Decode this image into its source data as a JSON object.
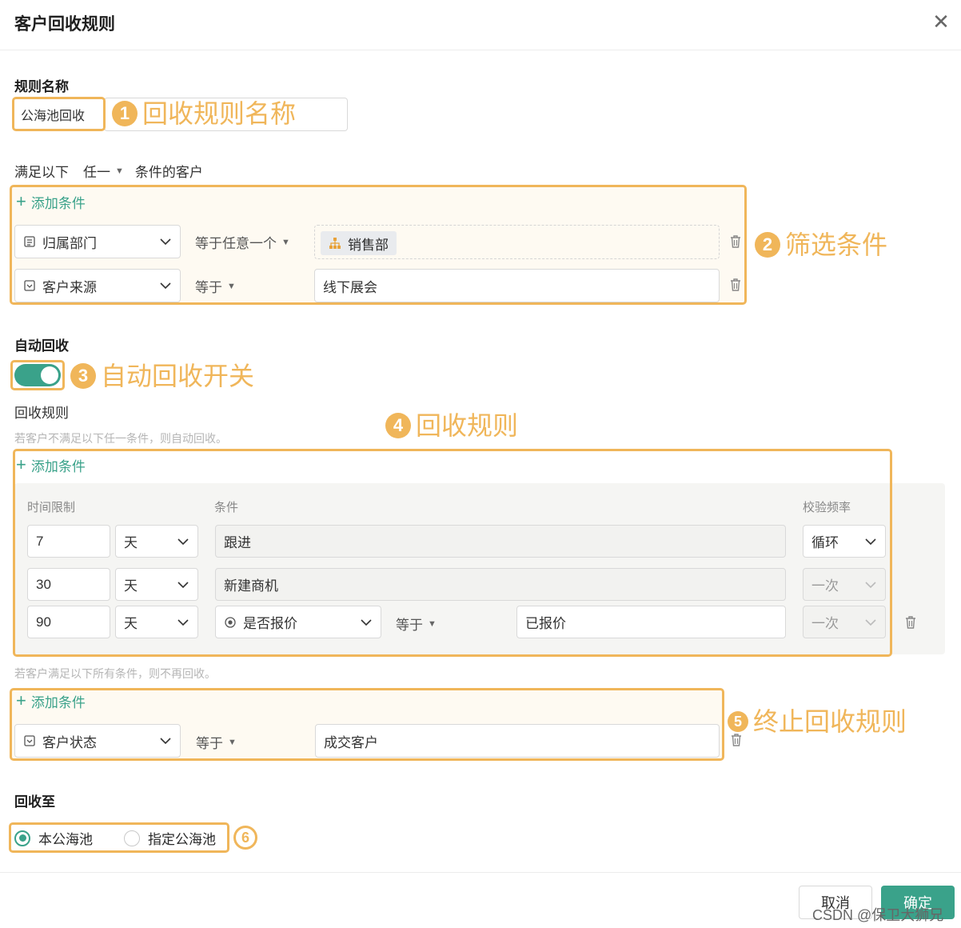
{
  "dialog": {
    "title": "客户回收规则",
    "close_icon": "close-icon"
  },
  "rule_name": {
    "label": "规则名称",
    "value": "公海池回收",
    "annotation_num": "1",
    "annotation": "回收规则名称"
  },
  "filter": {
    "prefix": "满足以下",
    "match": "任一",
    "suffix": "条件的客户",
    "add_label": "添加条件",
    "annotation_num": "2",
    "annotation": "筛选条件",
    "rows": [
      {
        "field": "归属部门",
        "operator": "等于任意一个",
        "value": "销售部"
      },
      {
        "field": "客户来源",
        "operator": "等于",
        "value": "线下展会"
      }
    ]
  },
  "auto_recycle": {
    "label": "自动回收",
    "enabled": true,
    "annotation_num": "3",
    "annotation": "自动回收开关"
  },
  "recycle_rule": {
    "label": "回收规则",
    "hint": "若客户不满足以下任一条件，则自动回收。",
    "add_label": "添加条件",
    "annotation_num": "4",
    "annotation": "回收规则",
    "columns": {
      "time": "时间限制",
      "condition": "条件",
      "freq": "校验频率"
    },
    "rows": [
      {
        "num": "7",
        "unit": "天",
        "condition": "跟进",
        "freq": "循环"
      },
      {
        "num": "30",
        "unit": "天",
        "condition": "新建商机",
        "freq": "一次"
      },
      {
        "num": "90",
        "unit": "天",
        "condition": "是否报价",
        "operator": "等于",
        "value": "已报价",
        "freq": "一次"
      }
    ]
  },
  "stop_rule": {
    "hint": "若客户满足以下所有条件，则不再回收。",
    "add_label": "添加条件",
    "annotation_num": "5",
    "annotation": "终止回收规则",
    "rows": [
      {
        "field": "客户状态",
        "operator": "等于",
        "value": "成交客户"
      }
    ]
  },
  "recycle_to": {
    "label": "回收至",
    "options": [
      "本公海池",
      "指定公海池"
    ],
    "selected": "本公海池",
    "annotation_num": "6"
  },
  "footer": {
    "cancel": "取消",
    "confirm": "确定",
    "watermark": "CSDN @保卫大狮兄"
  },
  "colors": {
    "accent": "#3aa28a",
    "annotation": "#f0b65a"
  }
}
